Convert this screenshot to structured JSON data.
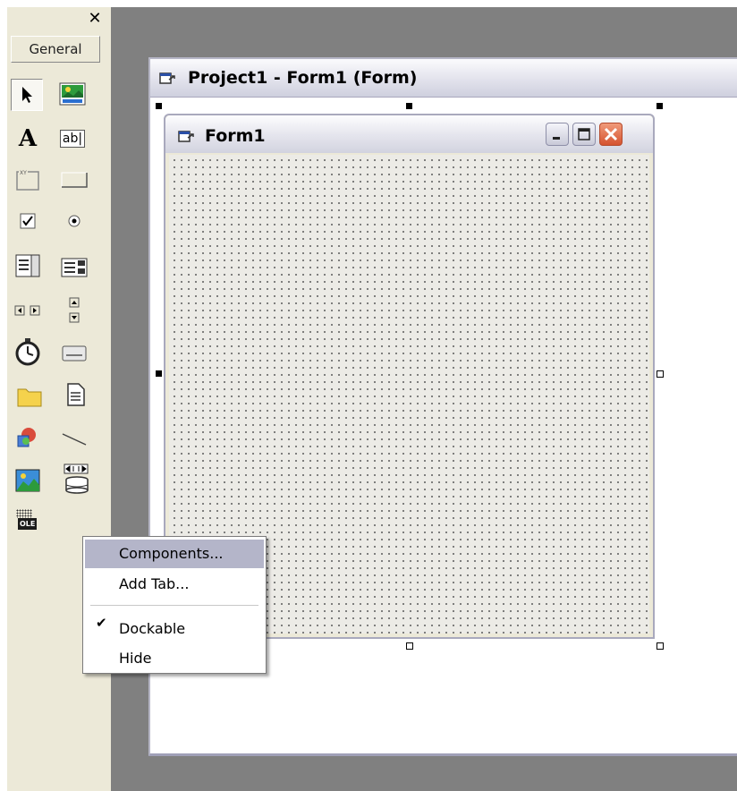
{
  "toolbox": {
    "close_glyph": "✕",
    "tab_label": "General",
    "tools": [
      {
        "name": "pointer-icon"
      },
      {
        "name": "picturebox-icon"
      },
      {
        "name": "label-icon",
        "glyph": "A"
      },
      {
        "name": "textbox-icon",
        "glyph": "ab|"
      },
      {
        "name": "frame-icon",
        "glyph": "xy"
      },
      {
        "name": "commandbutton-icon"
      },
      {
        "name": "checkbox-icon"
      },
      {
        "name": "optionbutton-icon"
      },
      {
        "name": "combobox-icon"
      },
      {
        "name": "listbox-icon"
      },
      {
        "name": "hscrollbar-icon"
      },
      {
        "name": "vscrollbar-icon"
      },
      {
        "name": "timer-icon"
      },
      {
        "name": "drivelistbox-icon"
      },
      {
        "name": "dirlistbox-icon"
      },
      {
        "name": "filelistbox-icon"
      },
      {
        "name": "shape-icon"
      },
      {
        "name": "line-icon"
      },
      {
        "name": "image-icon"
      },
      {
        "name": "data-icon"
      },
      {
        "name": "ole-icon",
        "glyph": "OLE"
      }
    ]
  },
  "project_window": {
    "title": "Project1 - Form1 (Form)"
  },
  "form": {
    "title": "Form1"
  },
  "context_menu": {
    "items": [
      {
        "label": "Components...",
        "highlighted": true
      },
      {
        "label": "Add Tab..."
      },
      {
        "label": "Dockable",
        "checked": true
      },
      {
        "label": "Hide"
      }
    ],
    "check_glyph": "✔"
  },
  "colors": {
    "workspace": "#808080",
    "toolbox": "#ece9d8",
    "menu_highlight": "#b4b5c9",
    "close_button": "#d5532f"
  }
}
